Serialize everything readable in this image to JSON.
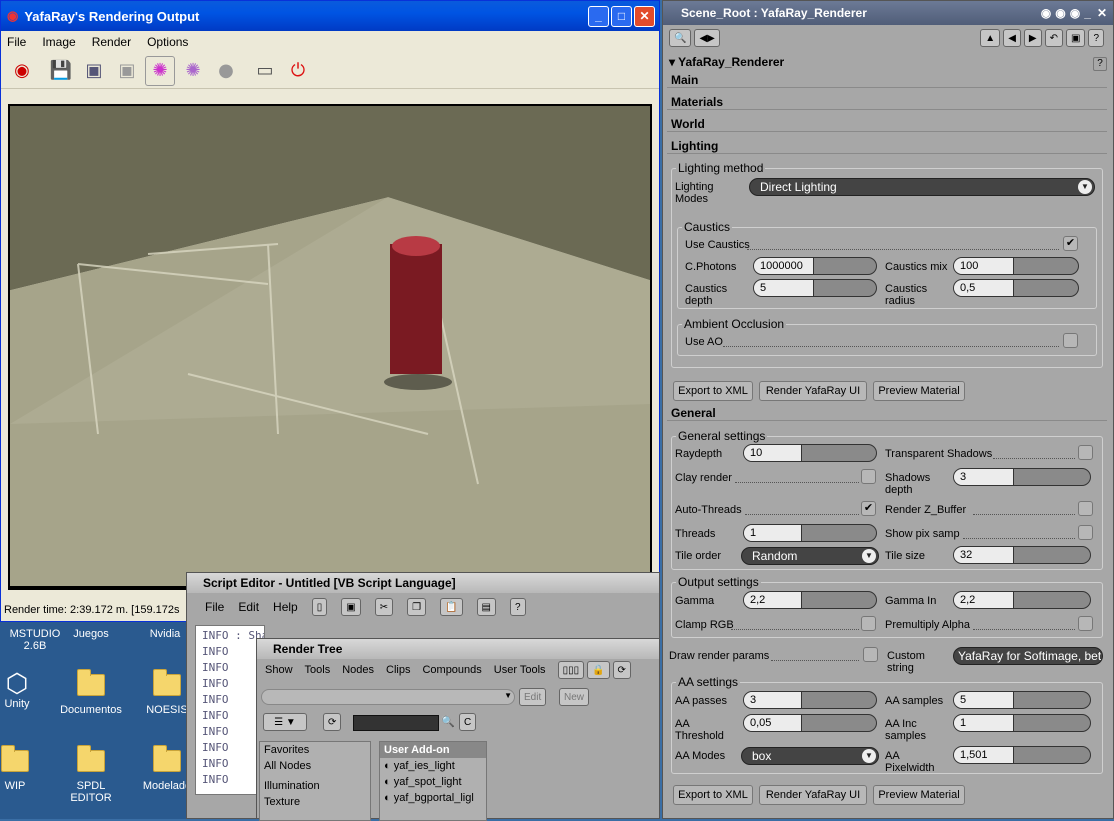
{
  "yafaray_window": {
    "title": "YafaRay's Rendering Output",
    "menu": [
      "File",
      "Image",
      "Render",
      "Options"
    ],
    "status": "Render time: 2:39.172 m. [159.172s"
  },
  "desktop": {
    "icons": [
      {
        "label": "MSTUDIO 2.6B"
      },
      {
        "label": "Juegos"
      },
      {
        "label": "Nvidia"
      },
      {
        "label": "Unity"
      },
      {
        "label": "Documentos"
      },
      {
        "label": "NOESIS"
      },
      {
        "label": "WIP"
      },
      {
        "label": "SPDL EDITOR"
      },
      {
        "label": "Modelado"
      }
    ]
  },
  "property_panel": {
    "title": "Scene_Root : YafaRay_Renderer",
    "header": "YafaRay_Renderer",
    "sections": {
      "main": "Main",
      "materials": "Materials",
      "world": "World",
      "lighting": "Lighting",
      "general": "General"
    },
    "lighting_method": {
      "group": "Lighting method",
      "modes_label": "Lighting Modes",
      "modes_value": "Direct Lighting"
    },
    "caustics": {
      "group": "Caustics",
      "use_label": "Use Caustics",
      "use_checked": "✔",
      "photons_label": "C.Photons",
      "photons_value": "1000000",
      "mix_label": "Caustics mix",
      "mix_value": "100",
      "depth_label": "Caustics depth",
      "depth_value": "5",
      "radius_label": "Caustics radius",
      "radius_value": "0,5"
    },
    "ao": {
      "group": "Ambient Occlusion",
      "use_label": "Use AO"
    },
    "buttons": {
      "export": "Export to XML",
      "render_ui": "Render YafaRay UI",
      "preview": "Preview Material"
    },
    "general_settings": {
      "group": "General settings",
      "raydepth_label": "Raydepth",
      "raydepth_value": "10",
      "transparent_shadows_label": "Transparent Shadows",
      "clay_label": "Clay render",
      "shadows_depth_label": "Shadows depth",
      "shadows_depth_value": "3",
      "auto_threads_label": "Auto-Threads",
      "auto_threads_checked": "✔",
      "render_zbuffer_label": "Render Z_Buffer",
      "threads_label": "Threads",
      "threads_value": "1",
      "show_pix_label": "Show pix samp",
      "tile_order_label": "Tile order",
      "tile_order_value": "Random",
      "tile_size_label": "Tile size",
      "tile_size_value": "32"
    },
    "output_settings": {
      "group": "Output settings",
      "gamma_label": "Gamma",
      "gamma_value": "2,2",
      "gamma_in_label": "Gamma In",
      "gamma_in_value": "2,2",
      "clamp_label": "Clamp RGB",
      "premultiply_label": "Premultiply Alpha"
    },
    "draw_params_label": "Draw render params",
    "custom_string_label": "Custom string",
    "custom_string_value": "YafaRay for Softimage, bet",
    "aa_settings": {
      "group": "AA settings",
      "passes_label": "AA passes",
      "passes_value": "3",
      "samples_label": "AA samples",
      "samples_value": "5",
      "threshold_label": "AA Threshold",
      "threshold_value": "0,05",
      "inc_samples_label": "AA Inc samples",
      "inc_samples_value": "1",
      "modes_label": "AA Modes",
      "modes_value": "box",
      "pixelwidth_label": "AA Pixelwidth",
      "pixelwidth_value": "1,501"
    }
  },
  "script_editor": {
    "title": "Script Editor - Untitled  [VB Script Language]",
    "menu": [
      "File",
      "Edit",
      "Help"
    ],
    "log_lines": [
      "INFO : Shader ID: yaf_shinydiffusemat",
      "INFO",
      "INFO",
      "INFO",
      "INFO",
      "INFO",
      "INFO",
      "INFO",
      "INFO",
      "INFO"
    ]
  },
  "render_tree": {
    "title": "Render Tree",
    "menu": [
      "Show",
      "Tools",
      "Nodes",
      "Clips",
      "Compounds",
      "User Tools"
    ],
    "edit_label": "Edit",
    "new_label": "New",
    "categories": [
      "Favorites",
      "All Nodes",
      "Illumination",
      "Texture"
    ],
    "addon_header": "User Add-on",
    "addon_items": [
      "yaf_ies_light",
      "yaf_spot_light",
      "yaf_bgportal_ligl"
    ]
  }
}
